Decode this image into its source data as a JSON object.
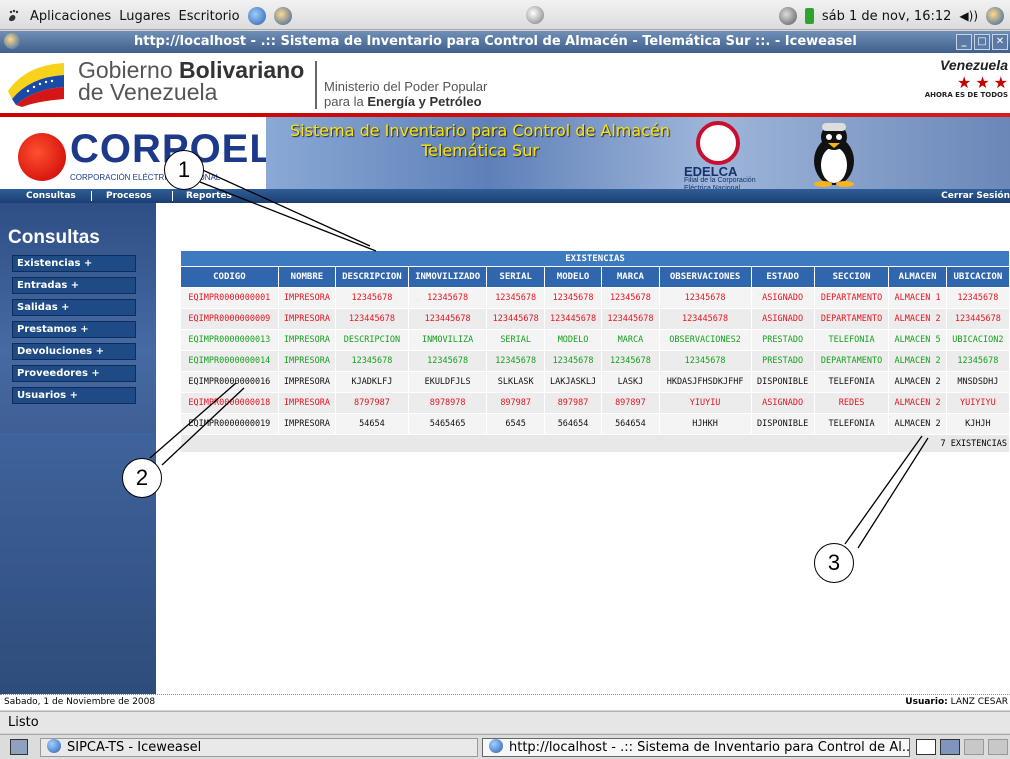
{
  "gnome_panel": {
    "menus": [
      "Aplicaciones",
      "Lugares",
      "Escritorio"
    ],
    "datetime": "sáb  1 de nov, 16:12"
  },
  "window": {
    "title": "http://localhost - .:: Sistema de Inventario para Control de Almacén - Telemática Sur ::. - Iceweasel"
  },
  "header": {
    "gov_line1_a": "Gobierno ",
    "gov_line1_b": "Bolivariano",
    "gov_line2": "de Venezuela",
    "ministry_line1": "Ministerio del Poder Popular",
    "ministry_line2_a": "para la ",
    "ministry_line2_b": "Energía y Petróleo",
    "venezuela": "Venezuela",
    "venezuela_slogan": "AHORA ES DE TODOS"
  },
  "banner": {
    "corpoelec": "CORPOELEC",
    "corpoelec_sub": "CORPORACIÓN ELÉCTRICA NACIONAL",
    "system_title_1": "Sistema de Inventario para Control de Almacén",
    "system_title_2": "Telemática Sur",
    "edelca": "EDELCA",
    "edelca_sub_1": "Filial de la Corporación",
    "edelca_sub_2": "Eléctrica Nacional"
  },
  "menubar": {
    "items": [
      "Consultas",
      "Procesos",
      "Reportes"
    ],
    "logout": "Cerrar Sesión"
  },
  "sidebar": {
    "title": "Consultas",
    "items": [
      "Existencias +",
      "Entradas +",
      "Salidas +",
      "Prestamos +",
      "Devoluciones +",
      "Proveedores +",
      "Usuarios +"
    ]
  },
  "table": {
    "caption": "EXISTENCIAS",
    "headers": [
      "CODIGO",
      "NOMBRE",
      "DESCRIPCION",
      "INMOVILIZADO",
      "SERIAL",
      "MODELO",
      "MARCA",
      "OBSERVACIONES",
      "ESTADO",
      "SECCION",
      "ALMACEN",
      "UBICACION"
    ],
    "rows": [
      {
        "color": "#e8141f",
        "cells": [
          "EQIMPR0000000001",
          "IMPRESORA",
          "12345678",
          "12345678",
          "12345678",
          "12345678",
          "12345678",
          "12345678",
          "ASIGNADO",
          "DEPARTAMENTO",
          "ALMACEN 1",
          "12345678"
        ]
      },
      {
        "color": "#e8141f",
        "cells": [
          "EQIMPR0000000009",
          "IMPRESORA",
          "123445678",
          "123445678",
          "123445678",
          "123445678",
          "123445678",
          "123445678",
          "ASIGNADO",
          "DEPARTAMENTO",
          "ALMACEN 2",
          "123445678"
        ]
      },
      {
        "color": "#16a01d",
        "cells": [
          "EQIMPR0000000013",
          "IMPRESORA",
          "DESCRIPCION",
          "INMOVILIZA",
          "SERIAL",
          "MODELO",
          "MARCA",
          "OBSERVACIONES2",
          "PRESTADO",
          "TELEFONIA",
          "ALMACEN 5",
          "UBICACION2"
        ]
      },
      {
        "color": "#16a01d",
        "cells": [
          "EQIMPR0000000014",
          "IMPRESORA",
          "12345678",
          "12345678",
          "12345678",
          "12345678",
          "12345678",
          "12345678",
          "PRESTADO",
          "DEPARTAMENTO",
          "ALMACEN 2",
          "12345678"
        ]
      },
      {
        "color": "#111111",
        "cells": [
          "EQIMPR0000000016",
          "IMPRESORA",
          "KJADKLFJ",
          "EKULDFJLS",
          "SLKLASK",
          "LAKJASKLJ",
          "LASKJ",
          "HKDASJFHSDKJFHF",
          "DISPONIBLE",
          "TELEFONIA",
          "ALMACEN 2",
          "MNSDSDHJ"
        ]
      },
      {
        "color": "#e8141f",
        "cells": [
          "EQIMPR0000000018",
          "IMPRESORA",
          "8797987",
          "8978978",
          "897987",
          "897987",
          "897897",
          "YIUYIU",
          "ASIGNADO",
          "REDES",
          "ALMACEN 2",
          "YUIYIYU"
        ]
      },
      {
        "color": "#111111",
        "cells": [
          "EQIMPR0000000019",
          "IMPRESORA",
          "54654",
          "5465465",
          "6545",
          "564654",
          "564654",
          "HJHKH",
          "DISPONIBLE",
          "TELEFONIA",
          "ALMACEN 2",
          "KJHJH"
        ]
      }
    ],
    "footer": "7 EXISTENCIAS"
  },
  "callouts": [
    "1",
    "2",
    "3"
  ],
  "page_status": {
    "date": "Sabado, 1 de Noviembre de 2008",
    "user_label": "Usuario:",
    "user_value": " LANZ CESAR"
  },
  "browser_status": "Listo",
  "taskbar": {
    "task1": "SIPCA-TS - Iceweasel",
    "task2": "http://localhost - .:: Sistema de Inventario para Control de Al..."
  },
  "colors": {
    "accent": "#2f66ad",
    "red_status": "#e8141f",
    "green_status": "#16a01d"
  }
}
